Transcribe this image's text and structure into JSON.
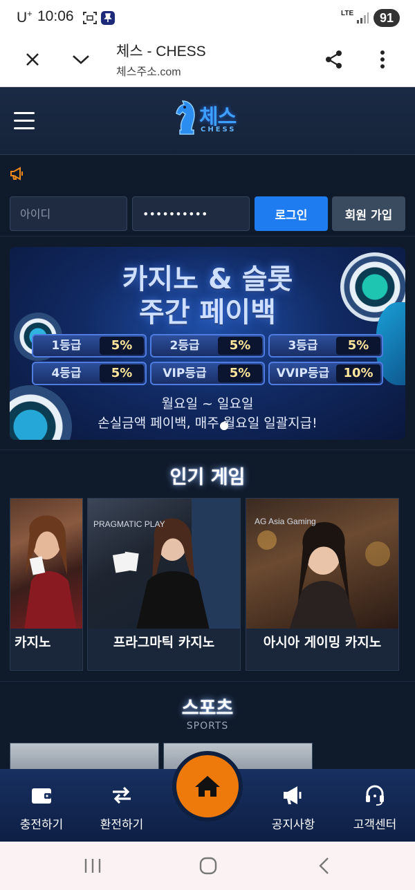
{
  "status_bar": {
    "carrier": "U",
    "carrier_sup": "+",
    "time": "10:06",
    "network": "LTE",
    "battery": "91"
  },
  "browser": {
    "title": "체스 - CHESS",
    "url": "체스주소.com"
  },
  "header": {
    "logo_korean": "체스",
    "logo_english": "CHESS"
  },
  "login": {
    "id_placeholder": "아이디",
    "password_value": "••••••••••",
    "login_label": "로그인",
    "join_label": "회원 가입"
  },
  "banner": {
    "title_line1": "카지노 & 슬롯",
    "title_line2": "주간 페이백",
    "tiers": [
      {
        "label": "1등급",
        "value": "5%"
      },
      {
        "label": "2등급",
        "value": "5%"
      },
      {
        "label": "3등급",
        "value": "5%"
      },
      {
        "label": "4등급",
        "value": "5%"
      },
      {
        "label": "VIP등급",
        "value": "5%"
      },
      {
        "label": "VVIP등급",
        "value": "10%"
      }
    ],
    "sub_line1": "월요일 ~ 일요일",
    "sub_line2": "손실금액 페이백, 매주 월요일 일괄지급!"
  },
  "popular": {
    "title": "인기 게임",
    "games": [
      {
        "name": "카지노",
        "provider": ""
      },
      {
        "name": "프라그마틱 카지노",
        "provider": "PRAGMATIC PLAY"
      },
      {
        "name": "아시아 게이밍 카지노",
        "provider": "AG Asia Gaming"
      }
    ]
  },
  "sports": {
    "title": "스포츠",
    "subtitle": "SPORTS"
  },
  "bottom_nav": {
    "items": [
      {
        "label": "충전하기",
        "icon": "wallet-icon"
      },
      {
        "label": "환전하기",
        "icon": "exchange-icon"
      },
      {
        "label": "공지사항",
        "icon": "megaphone-icon"
      },
      {
        "label": "고객센터",
        "icon": "headset-icon"
      }
    ],
    "home_icon": "home-icon"
  },
  "colors": {
    "accent_blue": "#1e7cf0",
    "home_orange": "#ef7a0c",
    "background": "#0f1a2b"
  }
}
